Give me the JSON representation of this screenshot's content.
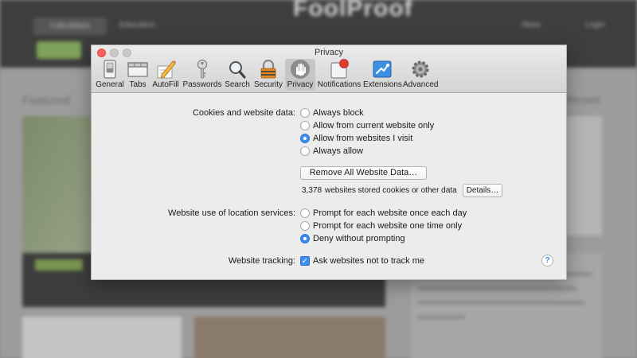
{
  "background": {
    "brand": "FoolProof",
    "nav_links": [
      "Calculators",
      "Education",
      "Store",
      "Login"
    ],
    "featured_heading": "Featured",
    "side_heading": "Recent"
  },
  "window": {
    "title": "Privacy",
    "toolbar": [
      {
        "label": "General",
        "icon": "general-switch-icon"
      },
      {
        "label": "Tabs",
        "icon": "tabs-icon"
      },
      {
        "label": "AutoFill",
        "icon": "autofill-pencil-icon"
      },
      {
        "label": "Passwords",
        "icon": "key-icon"
      },
      {
        "label": "Search",
        "icon": "magnifier-icon"
      },
      {
        "label": "Security",
        "icon": "lock-icon"
      },
      {
        "label": "Privacy",
        "icon": "hand-icon",
        "active": true
      },
      {
        "label": "Notifications",
        "icon": "notification-badge-icon"
      },
      {
        "label": "Extensions",
        "icon": "puzzle-icon"
      },
      {
        "label": "Advanced",
        "icon": "gear-icon"
      }
    ],
    "cookies": {
      "label": "Cookies and website data:",
      "options": [
        {
          "label": "Always block",
          "selected": false
        },
        {
          "label": "Allow from current website only",
          "selected": false
        },
        {
          "label": "Allow from websites I visit",
          "selected": true
        },
        {
          "label": "Always allow",
          "selected": false
        }
      ],
      "remove_button": "Remove All Website Data…",
      "stored_count": "3,378",
      "stored_text": "websites stored cookies or other data",
      "details_button": "Details…"
    },
    "location": {
      "label": "Website use of location services:",
      "options": [
        {
          "label": "Prompt for each website once each day",
          "selected": false
        },
        {
          "label": "Prompt for each website one time only",
          "selected": false
        },
        {
          "label": "Deny without prompting",
          "selected": true
        }
      ]
    },
    "tracking": {
      "label": "Website tracking:",
      "checkbox_label": "Ask websites not to track me",
      "checked": true
    },
    "help": "?"
  },
  "colors": {
    "accent": "#3d8cf0",
    "close_light": "#fc605c",
    "window_bg": "#ececec"
  }
}
